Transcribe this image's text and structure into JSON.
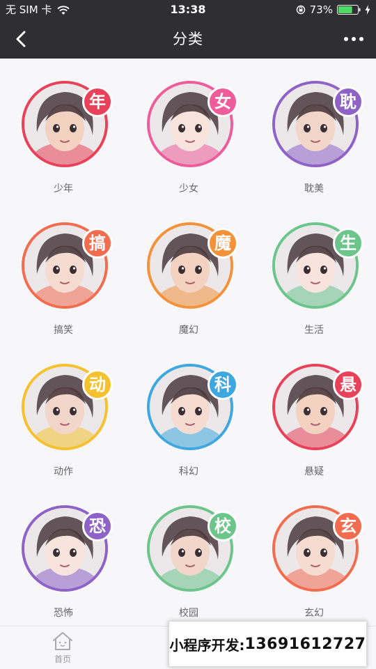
{
  "status_bar": {
    "carrier": "无 SIM 卡",
    "time": "13:38",
    "battery": "73%",
    "battery_level": 0.73
  },
  "nav": {
    "title": "分类"
  },
  "categories": [
    {
      "label": "少年",
      "badge": "年",
      "color": "#e94159"
    },
    {
      "label": "少女",
      "badge": "女",
      "color": "#ee5c9c"
    },
    {
      "label": "耽美",
      "badge": "耽",
      "color": "#8e62c6"
    },
    {
      "label": "搞笑",
      "badge": "搞",
      "color": "#f26c4f"
    },
    {
      "label": "魔幻",
      "badge": "魔",
      "color": "#f4923a"
    },
    {
      "label": "生活",
      "badge": "生",
      "color": "#6cc58a"
    },
    {
      "label": "动作",
      "badge": "动",
      "color": "#f5c12f"
    },
    {
      "label": "科幻",
      "badge": "科",
      "color": "#3fa7e0"
    },
    {
      "label": "悬疑",
      "badge": "悬",
      "color": "#e94159"
    },
    {
      "label": "恐怖",
      "badge": "恐",
      "color": "#8e62c6"
    },
    {
      "label": "校园",
      "badge": "校",
      "color": "#6cc58a"
    },
    {
      "label": "玄幻",
      "badge": "玄",
      "color": "#f26c4f"
    }
  ],
  "tab_bar": {
    "home_label": "首页"
  },
  "promo": {
    "prefix": "小程序开发: ",
    "phone": "13691612727"
  }
}
